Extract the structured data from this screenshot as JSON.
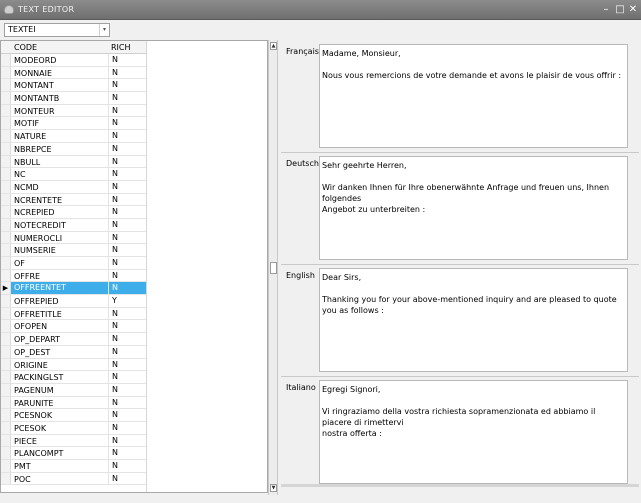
{
  "window": {
    "title": "TEXT EDITOR",
    "minimize": "–",
    "maximize": "□",
    "close": "✕"
  },
  "toolbar": {
    "selector_value": "TEXTEI",
    "selector_arrow": "▾"
  },
  "grid": {
    "headers": [
      "CODE",
      "RICH"
    ],
    "selected_index": 18,
    "row_indicator": "▶",
    "rows": [
      [
        "MODEORD",
        "N"
      ],
      [
        "MONNAIE",
        "N"
      ],
      [
        "MONTANT",
        "N"
      ],
      [
        "MONTANTB",
        "N"
      ],
      [
        "MONTEUR",
        "N"
      ],
      [
        "MOTIF",
        "N"
      ],
      [
        "NATURE",
        "N"
      ],
      [
        "NBREPCE",
        "N"
      ],
      [
        "NBULL",
        "N"
      ],
      [
        "NC",
        "N"
      ],
      [
        "NCMD",
        "N"
      ],
      [
        "NCRENTETE",
        "N"
      ],
      [
        "NCREPIED",
        "N"
      ],
      [
        "NOTECREDIT",
        "N"
      ],
      [
        "NUMEROCLI",
        "N"
      ],
      [
        "NUMSERIE",
        "N"
      ],
      [
        "OF",
        "N"
      ],
      [
        "OFFRE",
        "N"
      ],
      [
        "OFFREENTET",
        "N"
      ],
      [
        "OFFREPIED",
        "Y"
      ],
      [
        "OFFRETITLE",
        "N"
      ],
      [
        "OFOPEN",
        "N"
      ],
      [
        "OP_DEPART",
        "N"
      ],
      [
        "OP_DEST",
        "N"
      ],
      [
        "ORIGINE",
        "N"
      ],
      [
        "PACKINGLST",
        "N"
      ],
      [
        "PAGENUM",
        "N"
      ],
      [
        "PARUNITE",
        "N"
      ],
      [
        "PCESNOK",
        "N"
      ],
      [
        "PCESOK",
        "N"
      ],
      [
        "PIECE",
        "N"
      ],
      [
        "PLANCOMPT",
        "N"
      ],
      [
        "PMT",
        "N"
      ],
      [
        "POC",
        "N"
      ]
    ]
  },
  "splitter": {
    "up": "▲",
    "down": "▼"
  },
  "languages": [
    {
      "label": "Français",
      "lines": [
        "Madame, Monsieur,",
        "",
        "Nous vous remercions de votre demande et avons le plaisir de vous offrir :"
      ]
    },
    {
      "label": "Deutsch",
      "lines": [
        "Sehr geehrte Herren,",
        "",
        "Wir danken Ihnen für Ihre obenerwähnte Anfrage und freuen uns, Ihnen folgendes",
        "Angebot zu unterbreiten :"
      ]
    },
    {
      "label": "English",
      "lines": [
        "Dear Sirs,",
        "",
        "Thanking you for your above-mentioned inquiry and are pleased to quote you as follows :"
      ]
    },
    {
      "label": "Italiano",
      "lines": [
        "Egregi Signori,",
        "",
        "Vi ringraziamo della vostra richiesta sopramenzionata ed abbiamo il piacere di rimettervi",
        "nostra offerta :"
      ]
    }
  ],
  "colors": {
    "selection": "#3daee9",
    "titlebar": "#7a7a7a"
  }
}
